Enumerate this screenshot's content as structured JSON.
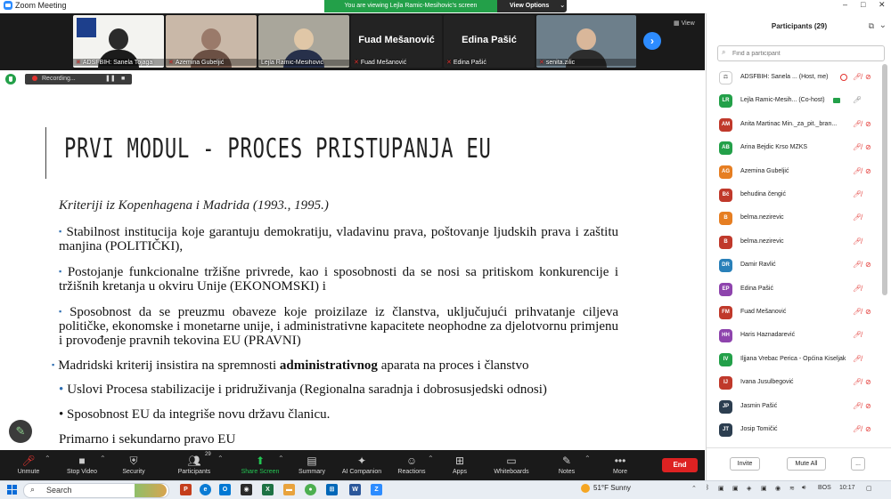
{
  "app": {
    "title": "Zoom Meeting",
    "banner": "You are viewing Lejla Ramic-Mesihovic's screen",
    "view_options": "View Options"
  },
  "window": {
    "minimize": "–",
    "maximize": "□",
    "close": "✕"
  },
  "video_strip": {
    "tiles": [
      {
        "name": "ADSFBIH: Sanela Tojaga"
      },
      {
        "name": "Azemina Gubeljić"
      },
      {
        "name": "Lejla Ramic-Mesihovic"
      },
      {
        "name": "Fuad Mešanović",
        "display": "Fuad Mešanović"
      },
      {
        "name": "Edina Pašić",
        "display": "Edina Pašić"
      },
      {
        "name": "senita.zilic"
      }
    ],
    "view_label": "View"
  },
  "recording": {
    "label": "Recording..."
  },
  "slide": {
    "title": "PRVI MODUL - PROCES PRISTUPANJA EU",
    "subtitle": "Kriteriji iz Kopenhagena i Madrida (1993., 1995.)",
    "b1": "Stabilnost institucija koje garantuju demokratiju, vladavinu prava, poštovanje ljudskih prava i zaštitu manjina (POLITIČKI),",
    "b2": "Postojanje funkcionalne tržišne privrede, kao i sposobnosti da se nosi sa pritiskom konkurencije i tržišnih kretanja u okviru Unije (EKONOMSKI) i",
    "b3": "Sposobnost da se preuzmu obaveze koje proizilaze iz članstva, uključujući prihvatanje ciljeva političke, ekonomske i monetarne unije, i administrativne kapacitete neophodne za djelotvornu primjenu i provođenje pravnih tekovina EU (PRAVNI)",
    "b4_pre": "Madridski kriterij insistira na spremnosti ",
    "b4_bold": "administrativnog",
    "b4_post": " aparata na proces i članstvo",
    "b5": "Uslovi Procesa stabilizacije i pridruživanja (Regionalna saradnja i dobrosusjedski odnosi)",
    "b6": "• Sposobnost EU da integriše novu državu članicu.",
    "b7": "Primarno i sekundarno pravo EU"
  },
  "toolbar": {
    "unmute": "Unmute",
    "stop_video": "Stop Video",
    "security": "Security",
    "participants": "Participants",
    "participants_count": "29",
    "share_screen": "Share Screen",
    "summary": "Summary",
    "ai_companion": "AI Companion",
    "reactions": "Reactions",
    "apps": "Apps",
    "whiteboards": "Whiteboards",
    "notes": "Notes",
    "more": "More",
    "end": "End"
  },
  "participants_panel": {
    "title": "Participants (29)",
    "search_placeholder": "Find a participant",
    "invite": "Invite",
    "mute_all": "Mute All",
    "more": "...",
    "rows": [
      {
        "initials": "",
        "name": "ADSFBIH: Sanela ... (Host, me)",
        "color": "#ffffff"
      },
      {
        "initials": "LR",
        "name": "Lejla Ramic-Mesih... (Co-host)",
        "color": "#23a049"
      },
      {
        "initials": "AM",
        "name": "Anita Martinac Min._za_pit._bran...",
        "color": "#c0392b"
      },
      {
        "initials": "AB",
        "name": "Arina Bejdic Krso MZKS",
        "color": "#23a049"
      },
      {
        "initials": "AG",
        "name": "Azemina Gubeljić",
        "color": "#e67e22"
      },
      {
        "initials": "Bč",
        "name": "behudina čengić",
        "color": "#c0392b"
      },
      {
        "initials": "B",
        "name": "belma.nezirevic",
        "color": "#e67e22"
      },
      {
        "initials": "B",
        "name": "belma.nezirevic",
        "color": "#c0392b"
      },
      {
        "initials": "DR",
        "name": "Damir Ravlić",
        "color": "#2980b9"
      },
      {
        "initials": "EP",
        "name": "Edina Pašić",
        "color": "#8e44ad"
      },
      {
        "initials": "FM",
        "name": "Fuad Mešanović",
        "color": "#c0392b"
      },
      {
        "initials": "HH",
        "name": "Haris Haznadarević",
        "color": "#8e44ad"
      },
      {
        "initials": "IV",
        "name": "Iljjana Vrebac Perica - Općina Kiseljak",
        "color": "#23a049"
      },
      {
        "initials": "IJ",
        "name": "Ivana Jusulbegović",
        "color": "#c0392b"
      },
      {
        "initials": "JP",
        "name": "Jasmin Pašić",
        "color": "#2c3e50"
      },
      {
        "initials": "JT",
        "name": "Josip Tomičić",
        "color": "#2c3e50"
      }
    ]
  },
  "taskbar": {
    "search": "Search",
    "weather": "51°F Sunny",
    "lang": "BOS",
    "time": "10:17"
  }
}
